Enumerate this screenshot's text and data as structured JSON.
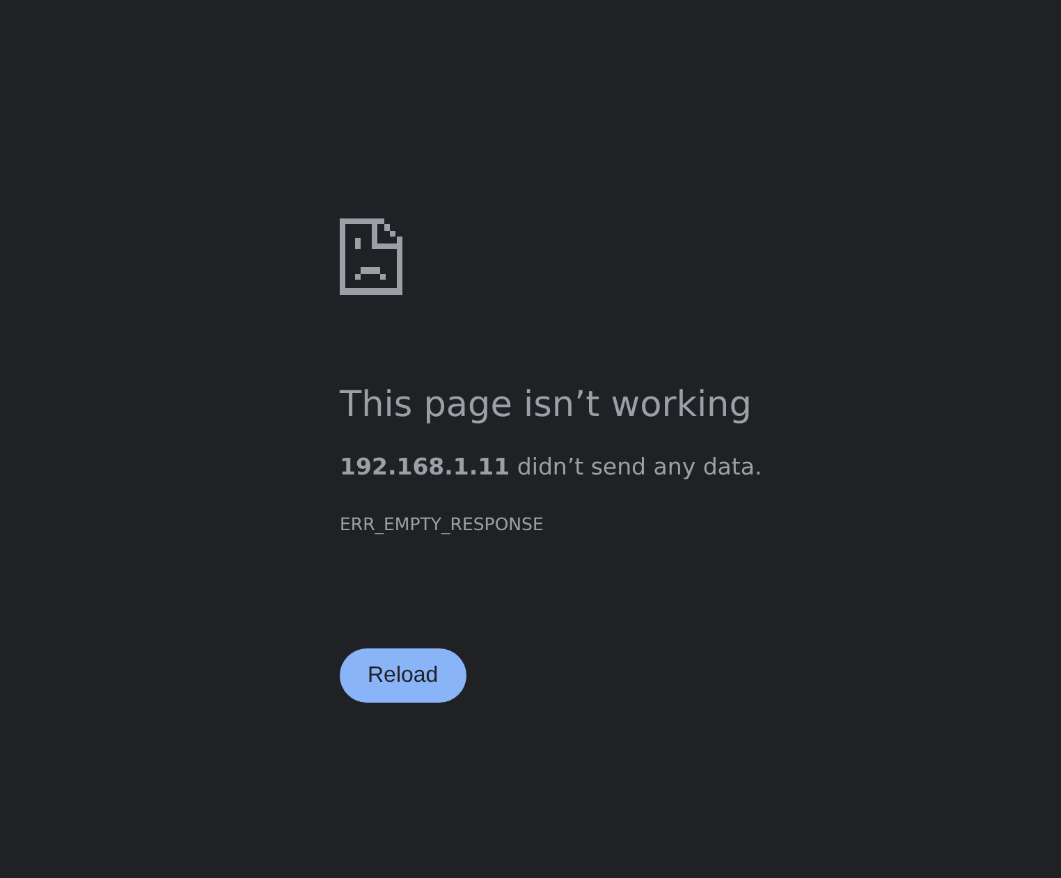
{
  "title": "This page isn’t working",
  "message": "**192.168.1.11** didn’t send any data.",
  "error_code": "ERR_EMPTY_RESPONSE",
  "buttons": [
    "Reload"
  ]
}
